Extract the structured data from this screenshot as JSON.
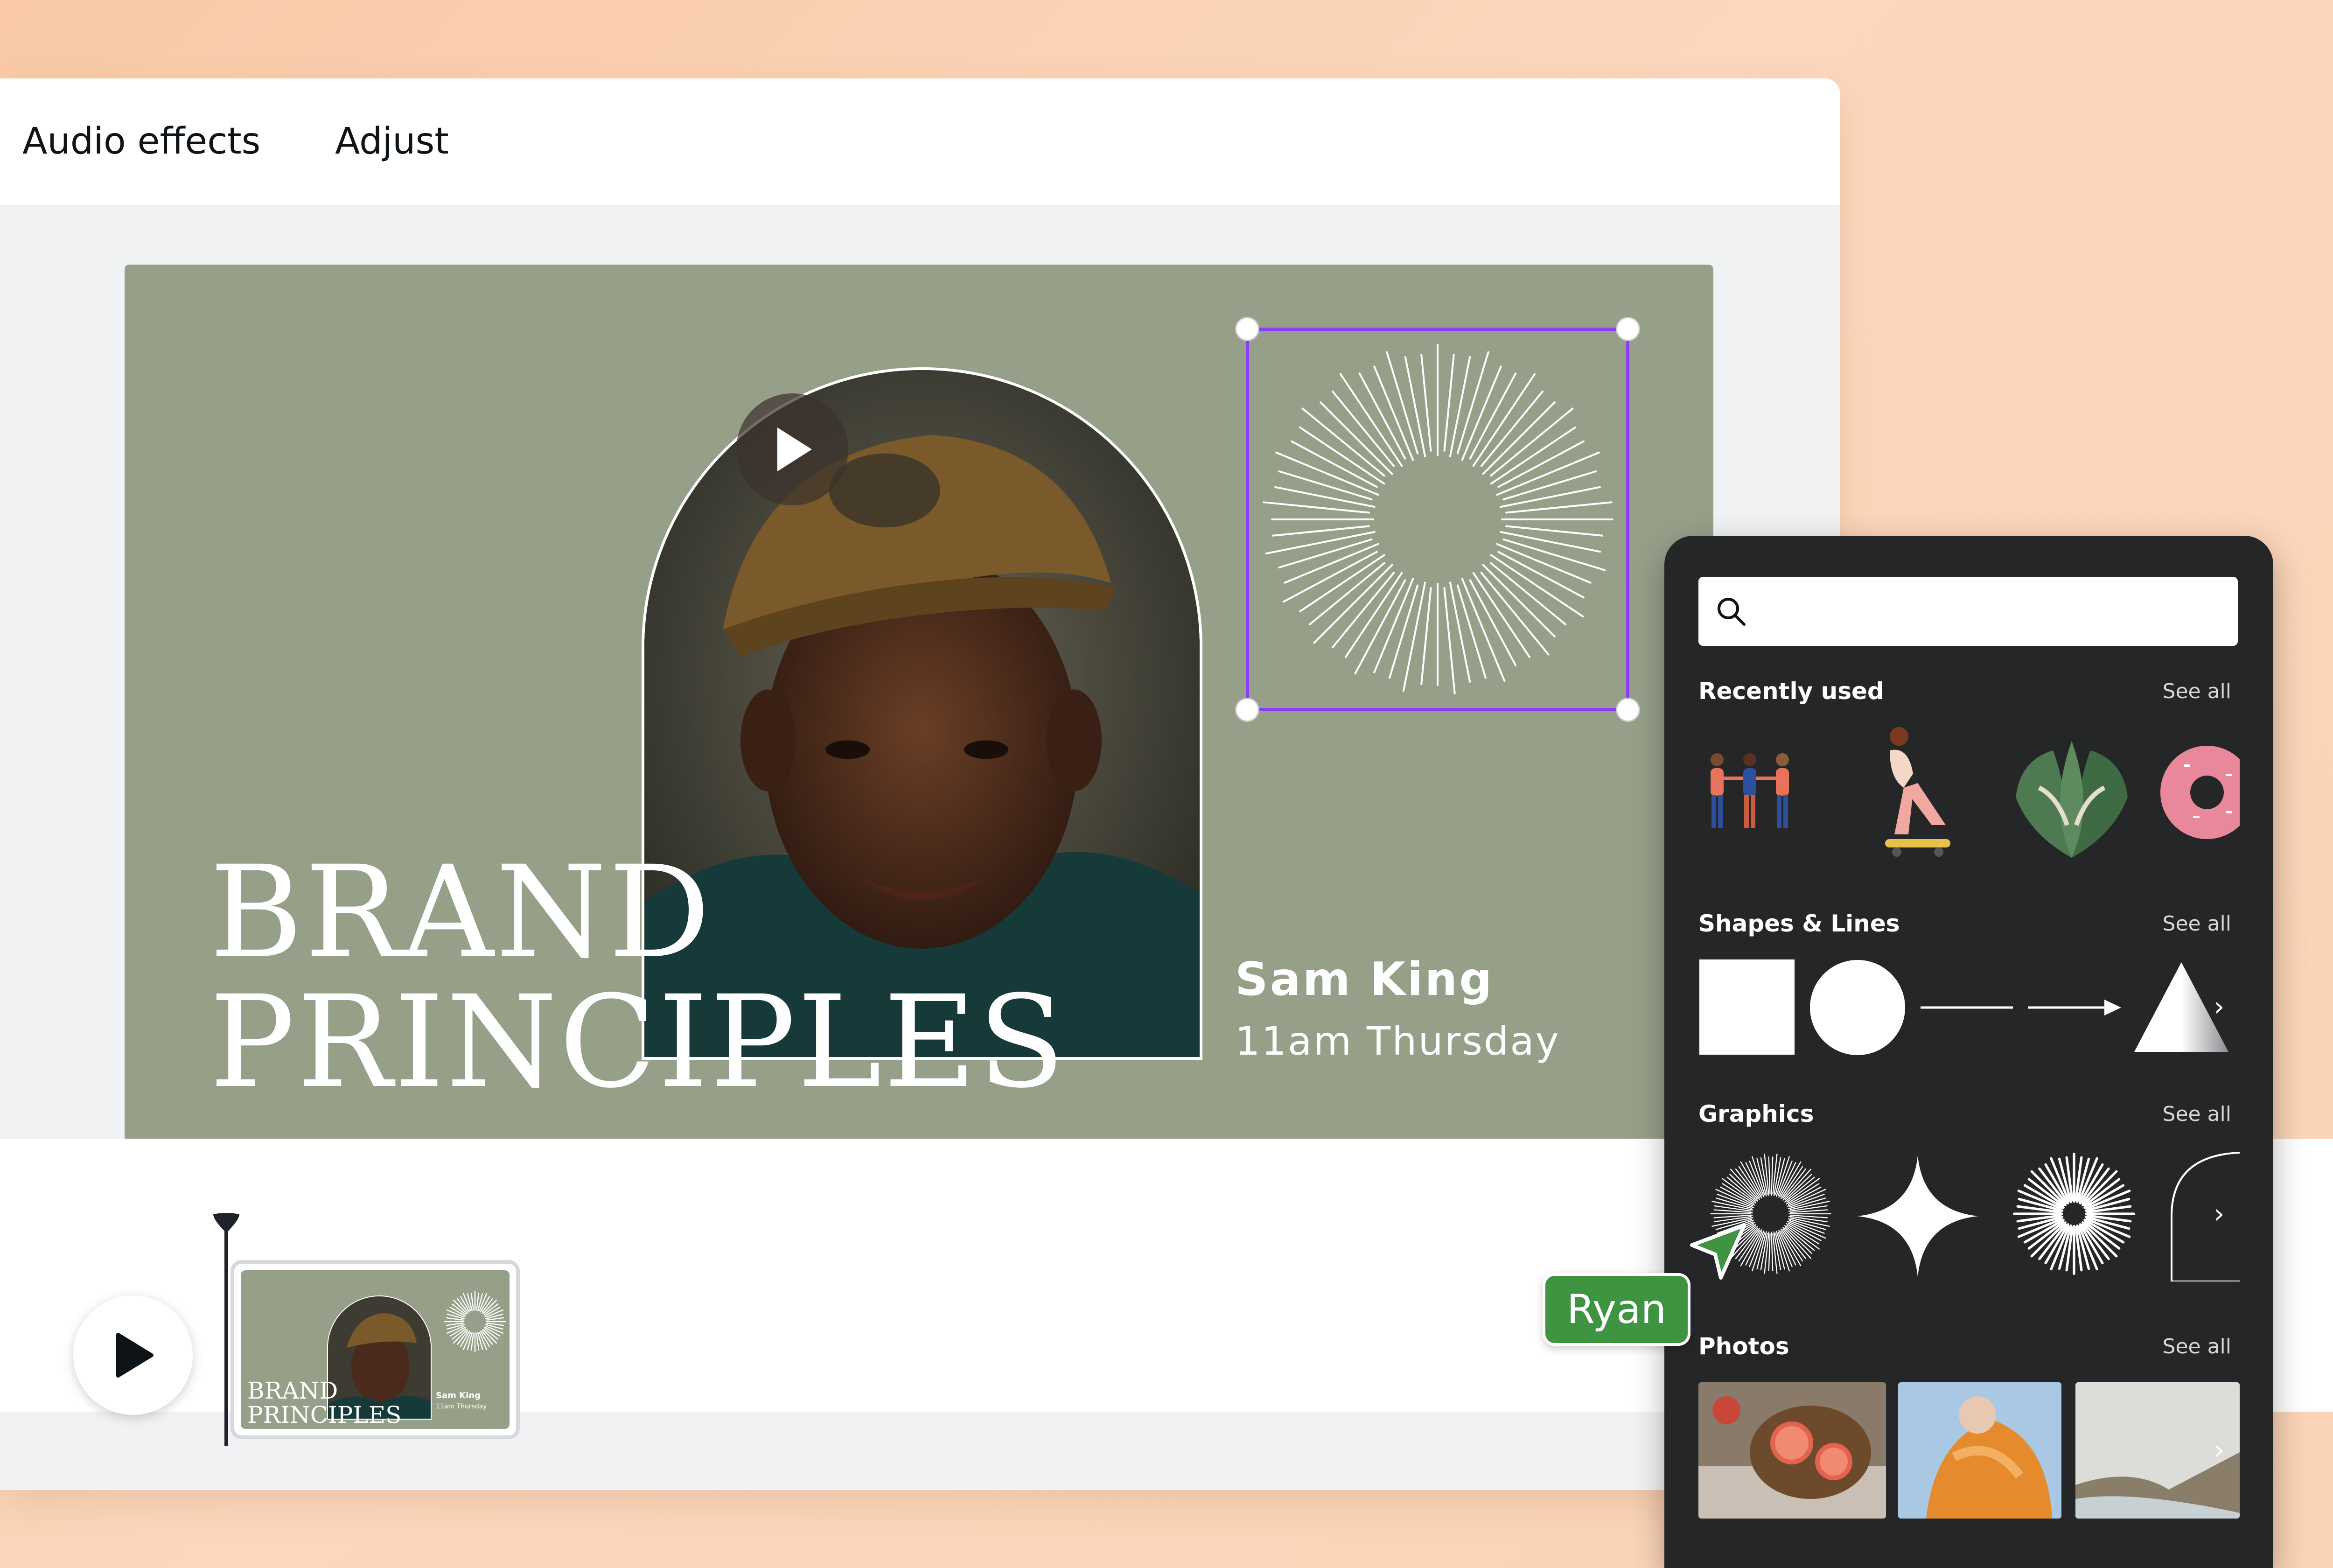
{
  "toolbar": {
    "tabs": [
      "Audio effects",
      "Adjust"
    ]
  },
  "slide": {
    "title_line1": "BRAND",
    "title_line2": "PRINCIPLES",
    "presenter_name": "Sam King",
    "presenter_time": "11am Thursday",
    "background_color": "#96a089",
    "selection_color": "#8b3dff"
  },
  "timeline": {
    "thumb_title_line1": "BRAND",
    "thumb_title_line2": "PRINCIPLES",
    "thumb_name": "Sam King",
    "thumb_time": "11am Thursday"
  },
  "collaborator": {
    "name": "Ryan",
    "color": "#3e9440"
  },
  "panel": {
    "search_placeholder": "",
    "sections": {
      "recent": {
        "title": "Recently used",
        "see_all": "See all"
      },
      "shapes": {
        "title": "Shapes & Lines",
        "see_all": "See all"
      },
      "graphics": {
        "title": "Graphics",
        "see_all": "See all"
      },
      "photos": {
        "title": "Photos",
        "see_all": "See all"
      }
    }
  },
  "icons": {
    "search": "search-icon",
    "play": "play-icon",
    "chevron": "chevron-right-icon",
    "cursor": "cursor-arrow-icon"
  }
}
